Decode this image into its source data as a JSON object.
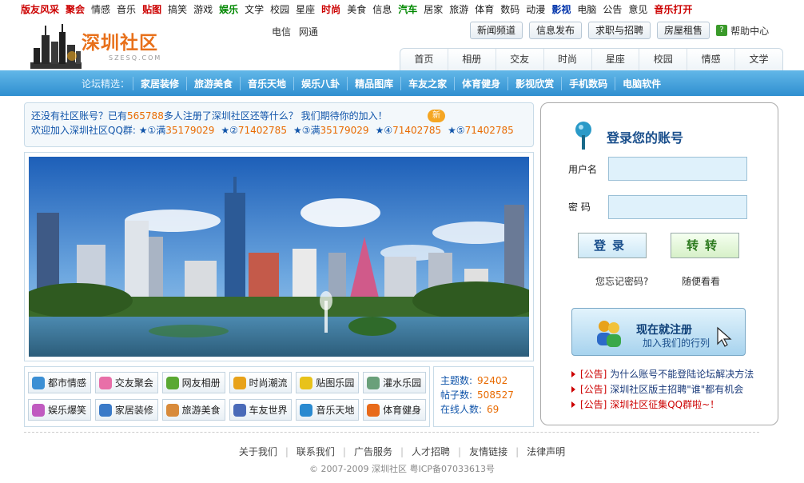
{
  "top_nav": [
    {
      "label": "版友风采",
      "style": "red"
    },
    {
      "label": "聚会",
      "style": "red"
    },
    {
      "label": "情感",
      "style": ""
    },
    {
      "label": "音乐",
      "style": ""
    },
    {
      "label": "贴图",
      "style": "red"
    },
    {
      "label": "搞笑",
      "style": ""
    },
    {
      "label": "游戏",
      "style": ""
    },
    {
      "label": "娱乐",
      "style": "green"
    },
    {
      "label": "文学",
      "style": ""
    },
    {
      "label": "校园",
      "style": ""
    },
    {
      "label": "星座",
      "style": ""
    },
    {
      "label": "时尚",
      "style": "red"
    },
    {
      "label": "美食",
      "style": ""
    },
    {
      "label": "信息",
      "style": ""
    },
    {
      "label": "汽车",
      "style": "green"
    },
    {
      "label": "居家",
      "style": ""
    },
    {
      "label": "旅游",
      "style": ""
    },
    {
      "label": "体育",
      "style": ""
    },
    {
      "label": "数码",
      "style": ""
    },
    {
      "label": "动漫",
      "style": ""
    },
    {
      "label": "影视",
      "style": "blue"
    },
    {
      "label": "电脑",
      "style": ""
    },
    {
      "label": "公告",
      "style": ""
    },
    {
      "label": "意见",
      "style": ""
    },
    {
      "label": "音乐打开",
      "style": "red"
    }
  ],
  "logo": {
    "title": "深圳社区",
    "subtitle": "SZESQ.COM"
  },
  "telecom": [
    "电信",
    "网通"
  ],
  "tool_buttons": [
    "新闻频道",
    "信息发布",
    "求职与招聘",
    "房屋租售"
  ],
  "help_label": "帮助中心",
  "tabs": [
    "首页",
    "相册",
    "交友",
    "时尚",
    "星座",
    "校园",
    "情感",
    "文学"
  ],
  "featured": {
    "label": "论坛精选：",
    "items": [
      "家居装修",
      "旅游美食",
      "音乐天地",
      "娱乐八卦",
      "精品图库",
      "车友之家",
      "体育健身",
      "影视欣赏",
      "手机数码",
      "电脑软件"
    ]
  },
  "notice": {
    "l1_pre": "还没有社区账号？已有",
    "l1_count": "565788",
    "l1_post": "多人注册了深圳社区还等什么？  我们期待你的加入！",
    "new_badge": "新",
    "l2_pre": "欢迎加入深圳社区QQ群: ",
    "groups": [
      {
        "label": "★①满",
        "num": "35179029"
      },
      {
        "label": "★②",
        "num": "71402785"
      },
      {
        "label": "★③满",
        "num": "35179029"
      },
      {
        "label": "★④",
        "num": "71402785"
      },
      {
        "label": "★⑤",
        "num": "71402785"
      }
    ]
  },
  "quick_links": [
    {
      "label": "都市情感",
      "color": "#3b8fd4"
    },
    {
      "label": "交友聚会",
      "color": "#e86fa8"
    },
    {
      "label": "网友相册",
      "color": "#5aa832"
    },
    {
      "label": "时尚潮流",
      "color": "#e8a21a"
    },
    {
      "label": "贴图乐园",
      "color": "#e8c21a"
    },
    {
      "label": "灌水乐园",
      "color": "#6aa07a"
    },
    {
      "label": "娱乐爆笑",
      "color": "#c05ac0"
    },
    {
      "label": "家居装修",
      "color": "#3a7ac8"
    },
    {
      "label": "旅游美食",
      "color": "#d88a3a"
    },
    {
      "label": "车友世界",
      "color": "#4a6ab8"
    },
    {
      "label": "音乐天地",
      "color": "#2a8ad0"
    },
    {
      "label": "体育健身",
      "color": "#e86a1a"
    }
  ],
  "stats": [
    {
      "label": "主题数:",
      "value": "92402"
    },
    {
      "label": "帖子数:",
      "value": "508527"
    },
    {
      "label": "在线人数:",
      "value": "69"
    }
  ],
  "login": {
    "title": "登录您的账号",
    "username_label": "用户名",
    "password_label": "密  码",
    "login_btn": "登录",
    "guest_btn": "转转",
    "forgot": "您忘记密码?",
    "browse": "随便看看",
    "register_title": "现在就注册",
    "register_sub": "加入我们的行列"
  },
  "announcements": [
    {
      "tag": "[公告]",
      "text": "为什么账号不能登陆论坛解决方法",
      "red": false
    },
    {
      "tag": "[公告]",
      "text": "深圳社区版主招聘\"谁\"都有机会",
      "red": false
    },
    {
      "tag": "[公告]",
      "text": "深圳社区征集QQ群啦~！",
      "red": true
    }
  ],
  "footer_links": [
    "关于我们",
    "联系我们",
    "广告服务",
    "人才招聘",
    "友情链接",
    "法律声明"
  ],
  "copyright": "© 2007-2009 深圳社区    粤ICP备07033613号"
}
